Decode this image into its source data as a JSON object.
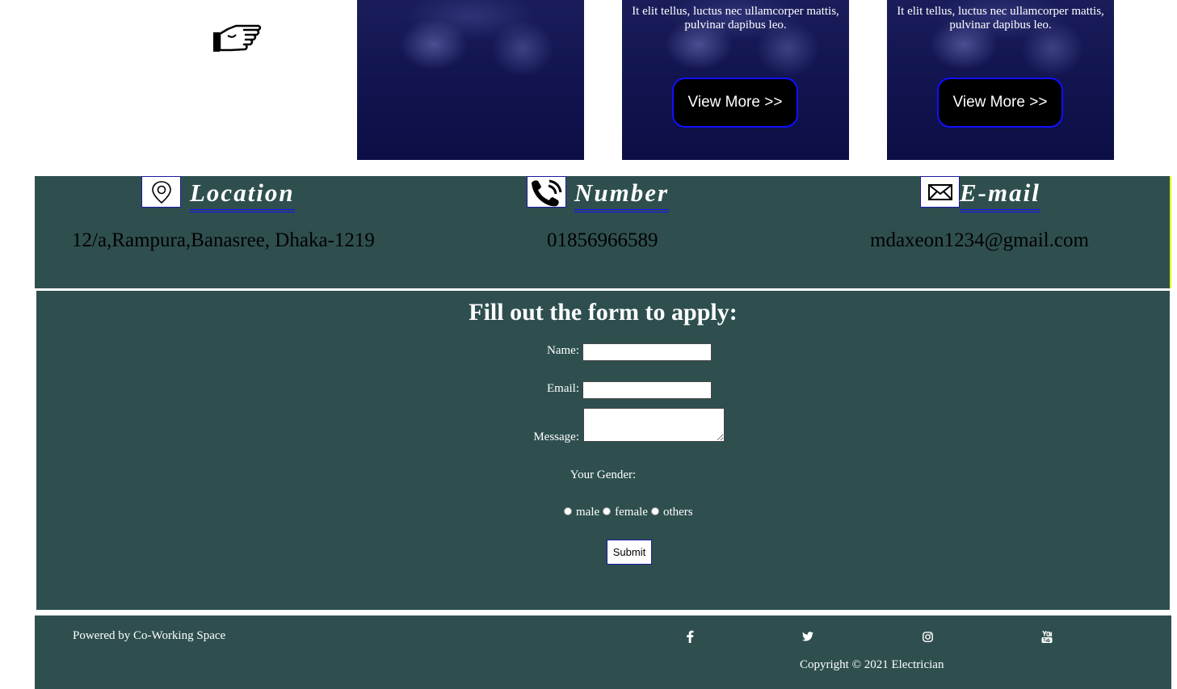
{
  "cards": [
    {
      "text": ""
    },
    {
      "text": "It elit tellus, luctus nec ullamcorper mattis, pulvinar dapibus leo.",
      "button": "View More >>"
    },
    {
      "text": "It elit tellus, luctus nec ullamcorper mattis, pulvinar dapibus leo.",
      "button": "View More >>"
    }
  ],
  "contact": {
    "location": {
      "heading": "Location",
      "value": "12/a,Rampura,Banasree, Dhaka-1219",
      "icon": "map-pin-icon"
    },
    "number": {
      "heading": "Number",
      "value": "01856966589",
      "icon": "phone-icon"
    },
    "email": {
      "heading": "E-mail",
      "value": "mdaxeon1234@gmail.com",
      "icon": "envelope-icon"
    }
  },
  "form": {
    "title": "Fill out the form to apply:",
    "name_label": "Name:",
    "email_label": "Email:",
    "message_label": "Message:",
    "gender_label": "Your Gender:",
    "genders": [
      "male",
      "female",
      "others"
    ],
    "submit": "Submit"
  },
  "footer": {
    "powered": "Powered by Co-Working Space",
    "social": [
      "facebook-icon",
      "twitter-icon",
      "instagram-icon",
      "youtube-icon"
    ],
    "copyright": "Copyright © 2021 Electrician"
  },
  "colors": {
    "panel": "#2f4f4f",
    "card": "#121550",
    "accent_blue": "#1010ff"
  }
}
